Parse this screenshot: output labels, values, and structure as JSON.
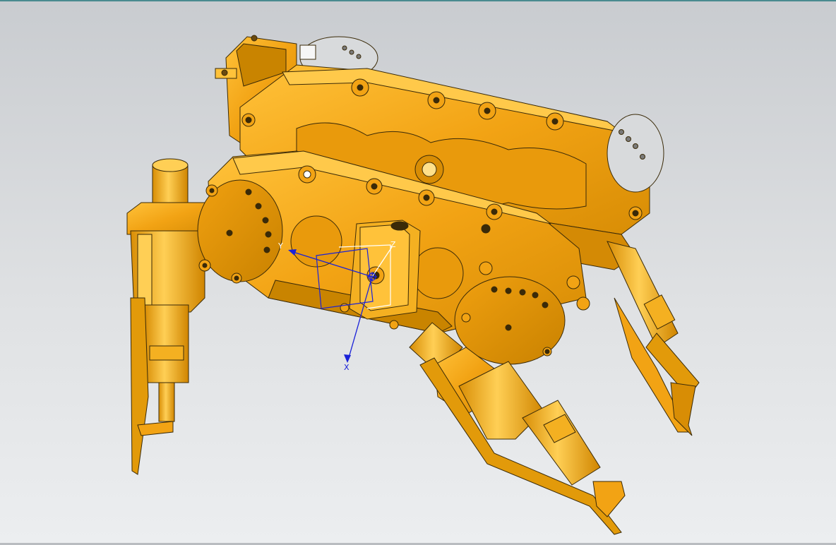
{
  "viewport": {
    "background_top": "#c9ccd0",
    "background_bottom": "#eceef0",
    "frame_color": "#4a8a8f"
  },
  "model": {
    "body_color": "#f0a414",
    "edge_color": "#3a2a08",
    "highlight_color": "#ffc94a",
    "shadow_color": "#c98400"
  },
  "triad": {
    "axis_color": "#1a22d8",
    "box_color": "#ffffff",
    "x_label": "X",
    "y_label": "Y",
    "z_label": "Z"
  }
}
